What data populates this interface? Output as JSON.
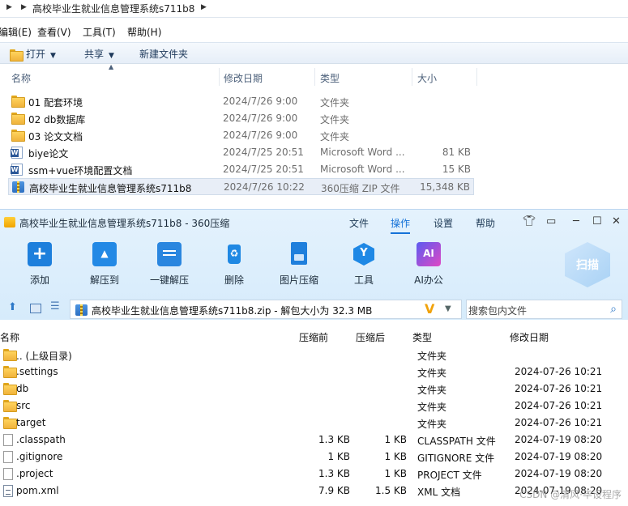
{
  "explorer": {
    "path": "高校毕业生就业信息管理系统s711b8",
    "menu": [
      "编辑(E)",
      "查看(V)",
      "工具(T)",
      "帮助(H)"
    ],
    "toolbar": {
      "open": "打开",
      "share": "共享",
      "new_folder": "新建文件夹"
    },
    "columns": {
      "name": "名称",
      "modified": "修改日期",
      "type": "类型",
      "size": "大小"
    },
    "rows": [
      {
        "icon": "folder-icon",
        "name": "01 配套环境",
        "date": "2024/7/26 9:00",
        "type": "文件夹",
        "size": ""
      },
      {
        "icon": "folder-icon",
        "name": "02 db数据库",
        "date": "2024/7/26 9:00",
        "type": "文件夹",
        "size": ""
      },
      {
        "icon": "folder-icon",
        "name": "03 论文文档",
        "date": "2024/7/26 9:00",
        "type": "文件夹",
        "size": ""
      },
      {
        "icon": "word-doc-icon",
        "name": "biye论文",
        "date": "2024/7/25 20:51",
        "type": "Microsoft Word ...",
        "size": "81 KB"
      },
      {
        "icon": "word-doc-icon",
        "name": "ssm+vue环境配置文档",
        "date": "2024/7/25 20:51",
        "type": "Microsoft Word ...",
        "size": "15 KB"
      },
      {
        "icon": "zip-archive-icon",
        "name": "高校毕业生就业信息管理系统s711b8",
        "date": "2024/7/26 10:22",
        "type": "360压缩 ZIP 文件",
        "size": "15,348 KB"
      }
    ]
  },
  "zip": {
    "title": "高校毕业生就业信息管理系统s711b8 - 360压缩",
    "tabs": [
      "文件",
      "操作",
      "设置",
      "帮助"
    ],
    "tools": [
      "添加",
      "解压到",
      "一键解压",
      "删除",
      "图片压缩",
      "工具",
      "AI办公"
    ],
    "scan_label": "扫描",
    "path": "高校毕业生就业信息管理系统s711b8.zip - 解包大小为 32.3 MB",
    "search_placeholder": "搜索包内文件",
    "columns": {
      "name": "名称",
      "compressed_before": "压缩前",
      "compressed_after": "压缩后",
      "type": "类型",
      "modified": "修改日期"
    },
    "rows": [
      {
        "icon": "folder-icon",
        "name": ".. (上级目录)",
        "before": "",
        "after": "",
        "type": "文件夹",
        "modified": ""
      },
      {
        "icon": "folder-icon",
        "name": ".settings",
        "before": "",
        "after": "",
        "type": "文件夹",
        "modified": "2024-07-26 10:21"
      },
      {
        "icon": "folder-icon",
        "name": "db",
        "before": "",
        "after": "",
        "type": "文件夹",
        "modified": "2024-07-26 10:21"
      },
      {
        "icon": "folder-icon",
        "name": "src",
        "before": "",
        "after": "",
        "type": "文件夹",
        "modified": "2024-07-26 10:21"
      },
      {
        "icon": "folder-icon",
        "name": "target",
        "before": "",
        "after": "",
        "type": "文件夹",
        "modified": "2024-07-26 10:21"
      },
      {
        "icon": "file-icon",
        "name": ".classpath",
        "before": "1.3 KB",
        "after": "1 KB",
        "type": "CLASSPATH 文件",
        "modified": "2024-07-19 08:20"
      },
      {
        "icon": "file-icon",
        "name": ".gitignore",
        "before": "1 KB",
        "after": "1 KB",
        "type": "GITIGNORE 文件",
        "modified": "2024-07-19 08:20"
      },
      {
        "icon": "file-icon",
        "name": ".project",
        "before": "1.3 KB",
        "after": "1 KB",
        "type": "PROJECT 文件",
        "modified": "2024-07-19 08:20"
      },
      {
        "icon": "xml-file-icon",
        "name": "pom.xml",
        "before": "7.9 KB",
        "after": "1.5 KB",
        "type": "XML 文档",
        "modified": "2024-07-19 08:20"
      }
    ],
    "watermark": "CSDN @清风·毕设程序"
  }
}
